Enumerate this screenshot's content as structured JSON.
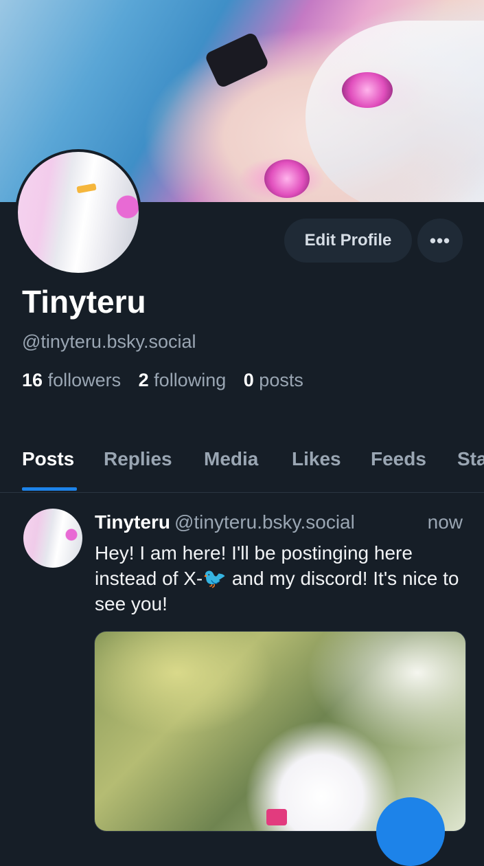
{
  "profile": {
    "display_name": "Tinyteru",
    "handle": "@tinyteru.bsky.social",
    "followers_count": "16",
    "followers_label": "followers",
    "following_count": "2",
    "following_label": "following",
    "posts_count": "0",
    "posts_label": "posts"
  },
  "actions": {
    "edit_label": "Edit Profile",
    "more_label": "•••"
  },
  "tabs": [
    {
      "label": "Posts",
      "active": true
    },
    {
      "label": "Replies",
      "active": false
    },
    {
      "label": "Media",
      "active": false
    },
    {
      "label": "Likes",
      "active": false
    },
    {
      "label": "Feeds",
      "active": false
    },
    {
      "label": "Sta",
      "active": false
    }
  ],
  "post": {
    "author": "Tinyteru",
    "handle": "@tinyteru.bsky.social",
    "time": "now",
    "text": "Hey! I am here! I'll be postinging here instead of X-🐦 and my discord! It's nice to see you!"
  },
  "colors": {
    "background": "#161e27",
    "accent": "#1d83e9",
    "muted_text": "#9aa6b3"
  }
}
